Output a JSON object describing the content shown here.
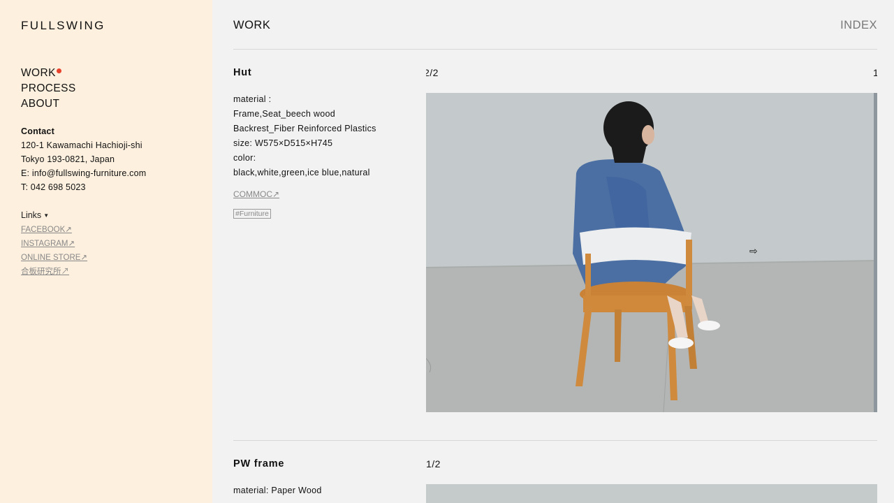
{
  "brand": {
    "logo": "FULLSWING"
  },
  "nav": {
    "items": [
      "WORK",
      "PROCESS",
      "ABOUT"
    ]
  },
  "contact": {
    "title": "Contact",
    "address1": "120-1 Kawamachi Hachioji-shi",
    "address2": "Tokyo 193-0821, Japan",
    "email": "E: info@fullswing-furniture.com",
    "phone": "T: 042 698 5023"
  },
  "links": {
    "title": "Links",
    "items": [
      "FACEBOOK↗",
      "INSTAGRAM↗",
      "ONLINE STORE↗",
      "合板研究所↗"
    ]
  },
  "header": {
    "title": "WORK",
    "index": "INDEX"
  },
  "items": [
    {
      "title": "Hut",
      "specs": [
        "material :",
        "Frame,Seat_beech wood",
        "Backrest_Fiber Reinforced Plastics",
        "size: W575×D515×H745",
        "color:",
        "black,white,green,ice blue,natural"
      ],
      "link": "COMMOC↗",
      "tag": "#Furniture",
      "counter_left": "2/2",
      "counter_right": "1",
      "image_icon": "photo-person-on-chair",
      "cursor_icon": "arrow-right-cursor-icon"
    },
    {
      "title": "PW frame",
      "specs": [
        "material: Paper Wood"
      ],
      "counter_left": "1/2",
      "image_icon": "photo-pw-frame"
    }
  ],
  "colors": {
    "sidebar_bg": "#fdf0de",
    "main_bg": "#f2f2f2",
    "accent_dot": "#e8412c"
  }
}
